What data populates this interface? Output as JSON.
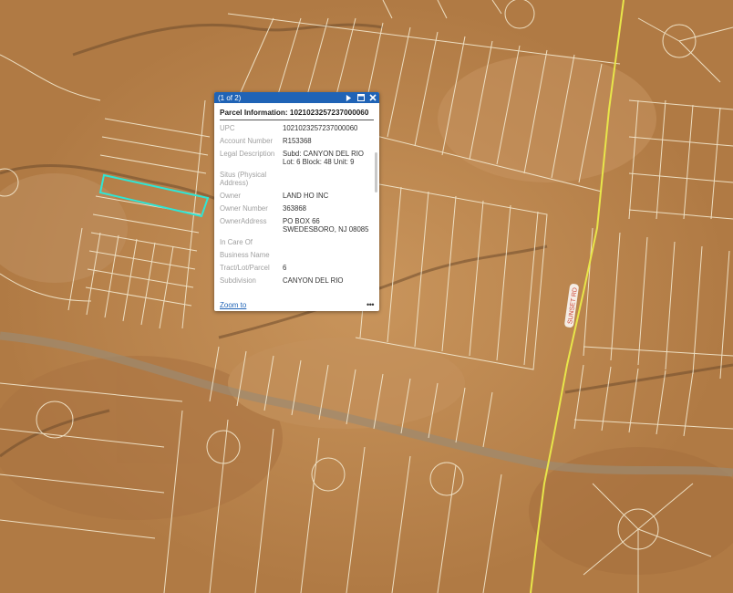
{
  "map": {
    "road_label": "SUNSET RD"
  },
  "popup": {
    "counter": "(1 of 2)",
    "title": "Parcel Information: 1021023257237000060",
    "attributes": [
      {
        "label": "UPC",
        "value": "1021023257237000060"
      },
      {
        "label": "Account Number",
        "value": "R153368"
      },
      {
        "label": "Legal Description",
        "value": "Subd: CANYON DEL RIO Lot: 6 Block: 48 Unit: 9"
      },
      {
        "label": "Situs (Physical Address)",
        "value": ""
      },
      {
        "label": "Owner",
        "value": "LAND HO INC"
      },
      {
        "label": "Owner Number",
        "value": "363868"
      },
      {
        "label": "OwnerAddress",
        "value": "PO BOX 66\nSWEDESBORO, NJ 08085"
      },
      {
        "label": "In Care Of",
        "value": ""
      },
      {
        "label": "Business Name",
        "value": ""
      },
      {
        "label": "Tract/Lot/Parcel",
        "value": "6"
      },
      {
        "label": "Subdivision",
        "value": "CANYON DEL RIO"
      }
    ],
    "zoom_label": "Zoom to",
    "more_label": "•••"
  },
  "colors": {
    "terrain": "#b8854e",
    "parcel_line": "#f4e9cf",
    "highlight": "#2ee6d6",
    "road": "#e8e64a",
    "header": "#1f63b6"
  },
  "icons": {
    "next": "play-triangle",
    "maximize": "window-icon",
    "close": "x-icon"
  }
}
